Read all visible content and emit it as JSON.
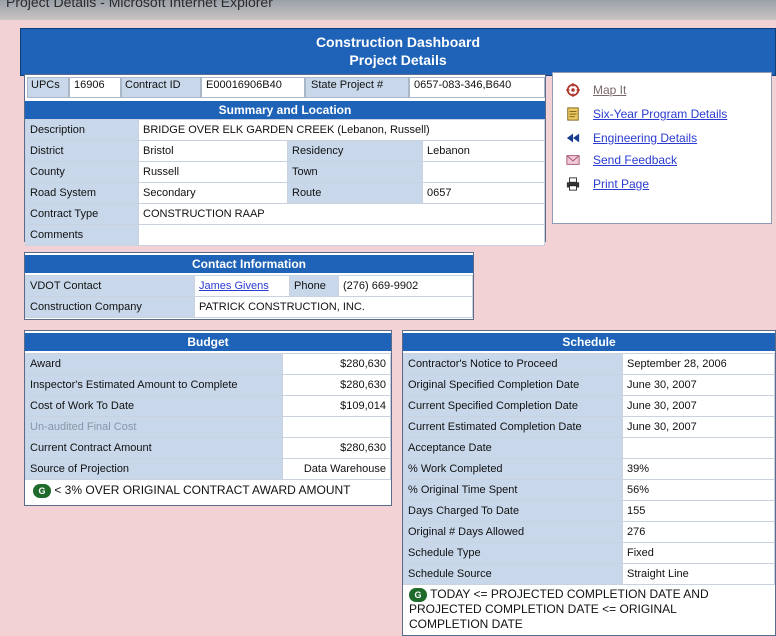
{
  "browser": {
    "title_fragment": "Project Details - Microsoft Internet Explorer"
  },
  "header": {
    "title": "Construction Dashboard",
    "subtitle": "Project Details"
  },
  "ids": {
    "upcs_label": "UPCs",
    "upcs_value": "16906",
    "contract_label": "Contract ID",
    "contract_value": "E00016906B40",
    "state_label": "State Project #",
    "state_value": "0657-083-346,B640"
  },
  "summary": {
    "title": "Summary and Location",
    "description_label": "Description",
    "description_value": "BRIDGE OVER ELK GARDEN CREEK (Lebanon, Russell)",
    "district_label": "District",
    "district_value": "Bristol",
    "residency_label": "Residency",
    "residency_value": "Lebanon",
    "county_label": "County",
    "county_value": "Russell",
    "town_label": "Town",
    "town_value": "",
    "road_label": "Road System",
    "road_value": "Secondary",
    "route_label": "Route",
    "route_value": "0657",
    "contract_type_label": "Contract Type",
    "contract_type_value": "CONSTRUCTION RAAP",
    "comments_label": "Comments",
    "comments_value": ""
  },
  "links": [
    {
      "label": "Map It",
      "icon": "map-target-icon"
    },
    {
      "label": "Six-Year Program Details",
      "icon": "document-icon"
    },
    {
      "label": "Engineering Details",
      "icon": "rewind-arrow-icon"
    },
    {
      "label": "Send Feedback",
      "icon": "envelope-icon"
    },
    {
      "label": "Print Page",
      "icon": "printer-icon"
    }
  ],
  "contact": {
    "title": "Contact Information",
    "vdot_label": "VDOT Contact",
    "vdot_value": "James Givens",
    "phone_label": "Phone",
    "phone_value": "(276) 669-9902",
    "company_label": "Construction Company",
    "company_value": "PATRICK CONSTRUCTION, INC."
  },
  "budget": {
    "title": "Budget",
    "rows": [
      {
        "label": "Award",
        "value": "$280,630"
      },
      {
        "label": "Inspector's Estimated Amount to Complete",
        "value": "$280,630"
      },
      {
        "label": "Cost of Work To Date",
        "value": "$109,014"
      },
      {
        "label": "Un-audited Final Cost",
        "value": ""
      },
      {
        "label": "Current Contract Amount",
        "value": "$280,630"
      },
      {
        "label": "Source of Projection",
        "value": "Data Warehouse"
      }
    ],
    "badge": "G",
    "status_text": "< 3% OVER ORIGINAL CONTRACT AWARD AMOUNT"
  },
  "schedule": {
    "title": "Schedule",
    "rows": [
      {
        "label": "Contractor's Notice to Proceed",
        "value": "September 28, 2006"
      },
      {
        "label": "Original Specified Completion Date",
        "value": "June 30, 2007"
      },
      {
        "label": "Current Specified Completion Date",
        "value": "June 30, 2007"
      },
      {
        "label": "Current Estimated Completion Date",
        "value": "June 30, 2007"
      },
      {
        "label": "Acceptance Date",
        "value": ""
      },
      {
        "label": "% Work Completed",
        "value": "39%"
      },
      {
        "label": "% Original Time Spent",
        "value": "56%"
      },
      {
        "label": "Days Charged To Date",
        "value": "155"
      },
      {
        "label": "Original # Days Allowed",
        "value": "276"
      },
      {
        "label": "Schedule Type",
        "value": "Fixed"
      },
      {
        "label": "Schedule Source",
        "value": "Straight Line"
      }
    ],
    "badge": "G",
    "status_line1": "TODAY <= PROJECTED COMPLETION DATE AND",
    "status_line2": "PROJECTED COMPLETION DATE <= ORIGINAL",
    "status_line3": "COMPLETION DATE"
  }
}
